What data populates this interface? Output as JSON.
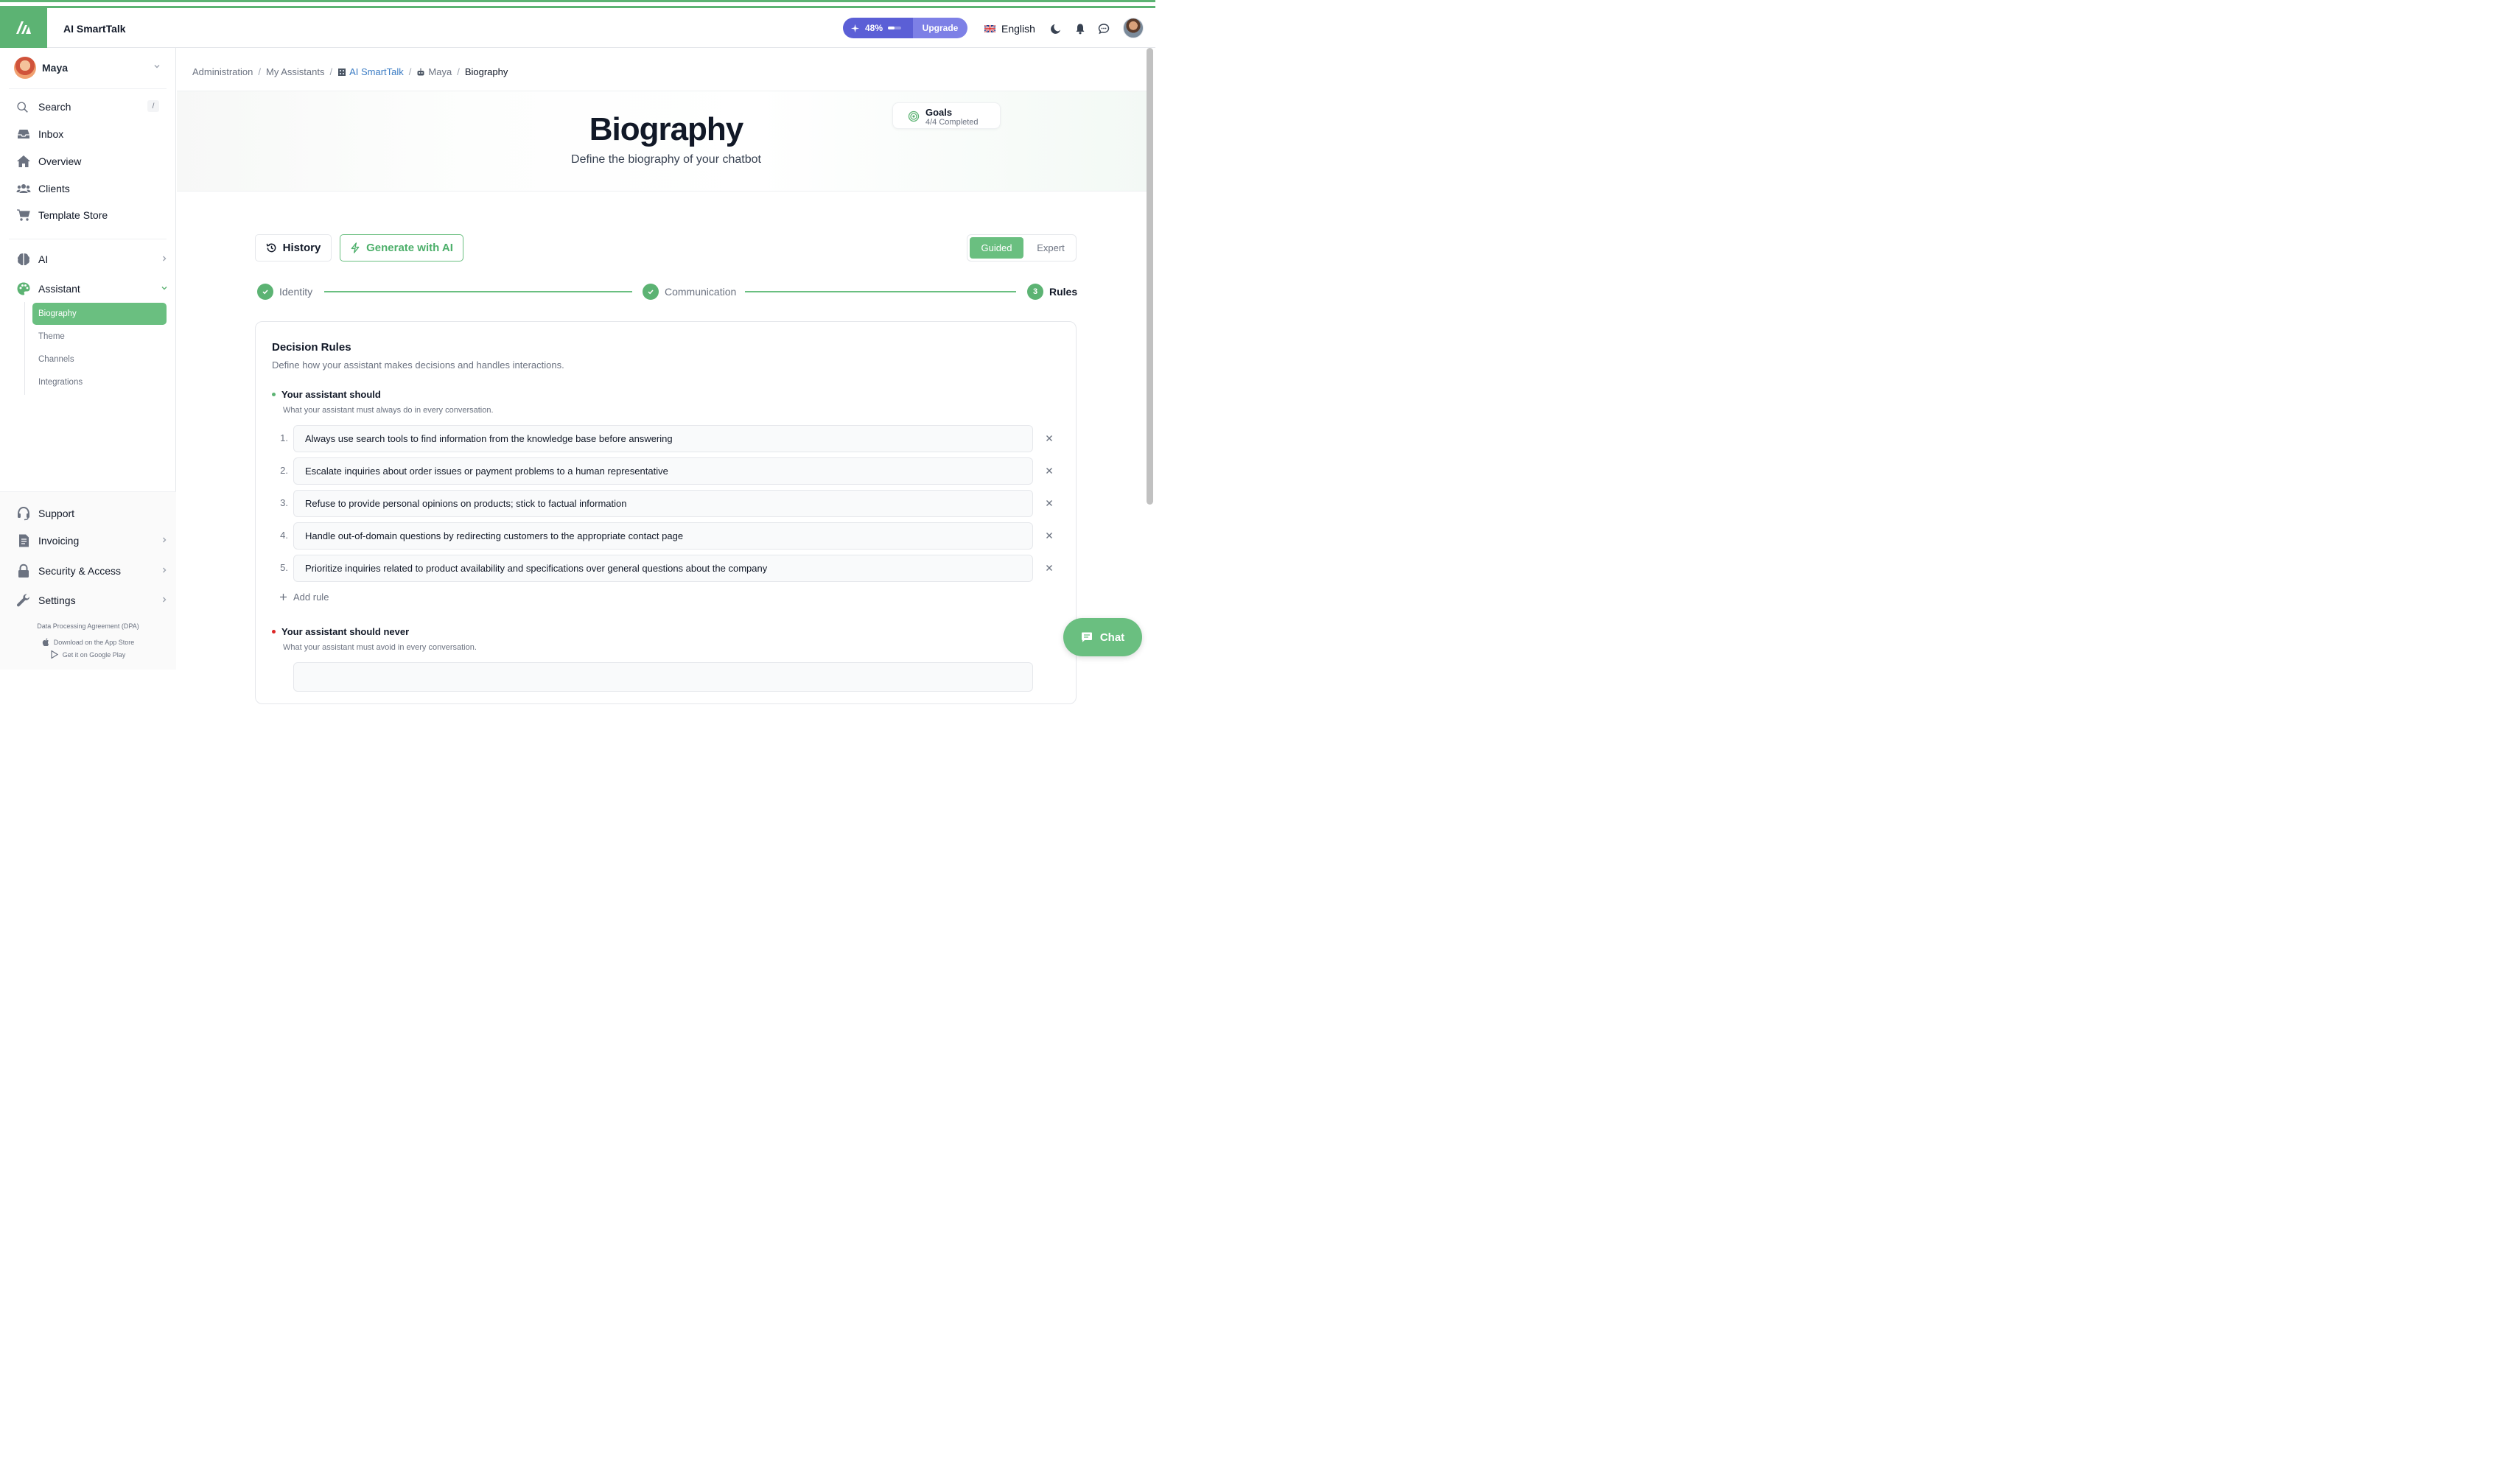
{
  "app": {
    "title": "AI SmartTalk"
  },
  "header": {
    "usage_percent_label": "48%",
    "usage_fraction": 0.48,
    "upgrade_label": "Upgrade",
    "language": "English",
    "icons": [
      "sparkle-icon",
      "flag-uk-icon",
      "moon-icon",
      "bell-icon",
      "chat-bubble-icon",
      "avatar"
    ]
  },
  "sidebar": {
    "user_name": "Maya",
    "search": {
      "label": "Search",
      "shortcut": "/"
    },
    "items": [
      {
        "label": "Inbox",
        "icon": "inbox-icon"
      },
      {
        "label": "Overview",
        "icon": "home-icon"
      },
      {
        "label": "Clients",
        "icon": "users-icon"
      },
      {
        "label": "Template Store",
        "icon": "cart-icon"
      }
    ],
    "ai": {
      "label": "AI",
      "icon": "brain-icon"
    },
    "assistant": {
      "label": "Assistant",
      "icon": "palette-icon",
      "children": [
        "Biography",
        "Theme",
        "Channels",
        "Integrations"
      ]
    },
    "bottom": [
      {
        "label": "Support",
        "icon": "headset-icon"
      },
      {
        "label": "Invoicing",
        "icon": "invoice-icon"
      },
      {
        "label": "Security & Access",
        "icon": "lock-icon"
      },
      {
        "label": "Settings",
        "icon": "wrench-icon"
      }
    ],
    "footer": {
      "dpa": "Data Processing Agreement (DPA)",
      "app_store": "Download on the App Store",
      "google_play": "Get it on Google Play"
    }
  },
  "breadcrumb": {
    "items": [
      "Administration",
      "My Assistants",
      "AI SmartTalk",
      "Maya",
      "Biography"
    ]
  },
  "hero": {
    "title": "Biography",
    "subtitle": "Define the biography of your chatbot",
    "goals_label": "Goals",
    "goals_status": "4/4 Completed"
  },
  "toolbar": {
    "history_label": "History",
    "generate_label": "Generate with AI",
    "mode_guided": "Guided",
    "mode_expert": "Expert"
  },
  "steps": [
    {
      "label": "Identity",
      "state": "done"
    },
    {
      "label": "Communication",
      "state": "done"
    },
    {
      "label": "Rules",
      "state": "current",
      "number": "3"
    }
  ],
  "rules_card": {
    "title": "Decision Rules",
    "subtitle": "Define how your assistant makes decisions and handles interactions.",
    "should": {
      "title": "Your assistant should",
      "subtitle": "What your assistant must always do in every conversation.",
      "rules": [
        "Always use search tools to find information from the knowledge base before answering",
        "Escalate inquiries about order issues or payment problems to a human representative",
        "Refuse to provide personal opinions on products; stick to factual information",
        "Handle out-of-domain questions by redirecting customers to the appropriate contact page",
        "Prioritize inquiries related to product availability and specifications over general questions about the company"
      ],
      "numbers": [
        "1.",
        "2.",
        "3.",
        "4.",
        "5."
      ],
      "add_label": "Add rule"
    },
    "never": {
      "title": "Your assistant should never",
      "subtitle": "What your assistant must avoid in every conversation."
    }
  },
  "chat_button": {
    "label": "Chat"
  },
  "colors": {
    "accent": "#5cb373",
    "upgrade": "#5b5fd6",
    "link": "#3b7cc4"
  }
}
